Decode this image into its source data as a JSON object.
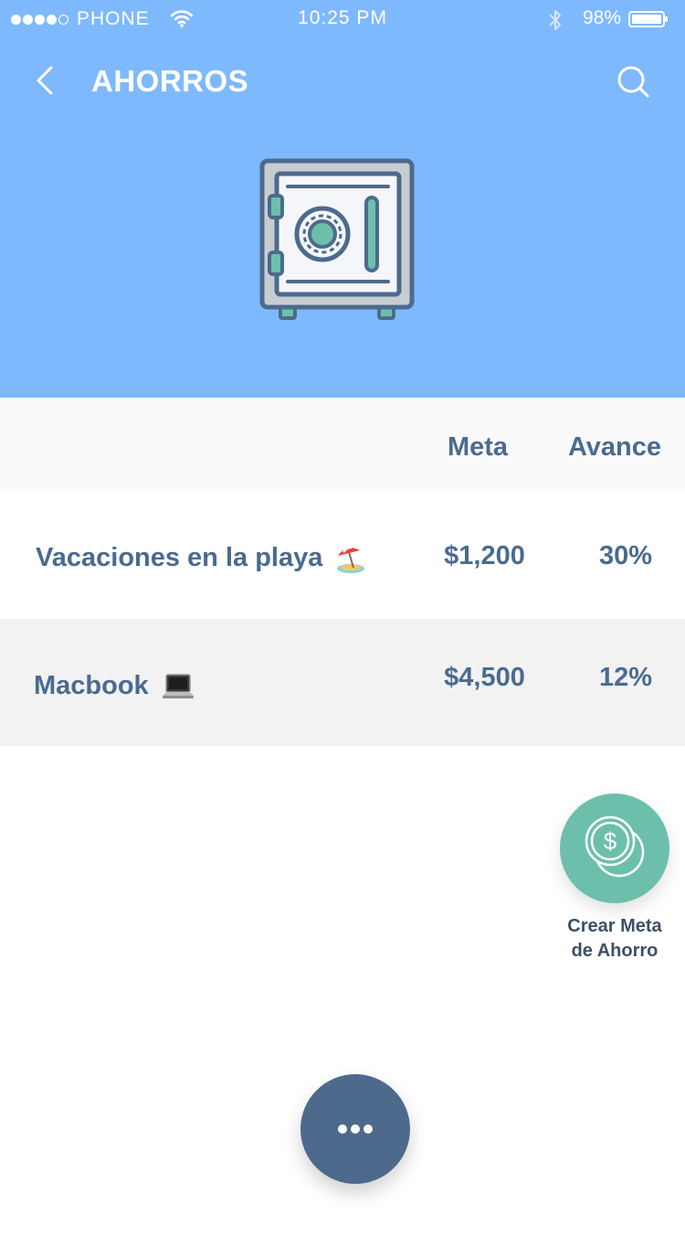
{
  "status_bar": {
    "carrier": "PHONE",
    "time": "10:25 PM",
    "battery": "98%"
  },
  "nav": {
    "title": "AHORROS",
    "back_icon": "chevron-left-icon",
    "search_icon": "search-icon"
  },
  "hero": {
    "icon": "safe-icon"
  },
  "table": {
    "headers": {
      "meta": "Meta",
      "avance": "Avance"
    },
    "rows": [
      {
        "name": "Vacaciones en la playa",
        "emoji": "beach-umbrella-icon",
        "meta": "$1,200",
        "avance": "30%"
      },
      {
        "name": "Macbook",
        "emoji": "laptop-icon",
        "meta": "$4,500",
        "avance": "12%"
      }
    ]
  },
  "actions": {
    "create_goal_line1": "Crear Meta",
    "create_goal_line2": "de Ahorro",
    "create_goal_icon": "coins-dollar-icon",
    "more_icon": "more-dots-icon"
  },
  "colors": {
    "header_bg": "#7fb9fd",
    "text_primary": "#4a6b90",
    "accent_green": "#6cc0ab",
    "fab_dark": "#4d6a8d",
    "row_alt_bg": "#f2f2f2"
  }
}
